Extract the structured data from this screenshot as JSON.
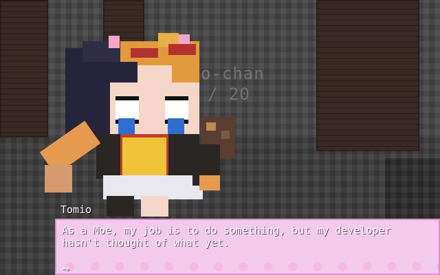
{
  "world": {
    "ghost_nameplate_line1": "o-chan",
    "ghost_nameplate_line2": "/ 20"
  },
  "dialog": {
    "speaker": "Tomio",
    "text": "As a Moe, my job is to do something, but my developer hasn't thought of what yet.",
    "continue_icon": "→"
  },
  "colors": {
    "dialog_bg": "#f3c9ec",
    "dialog_border": "#d98fcf"
  }
}
